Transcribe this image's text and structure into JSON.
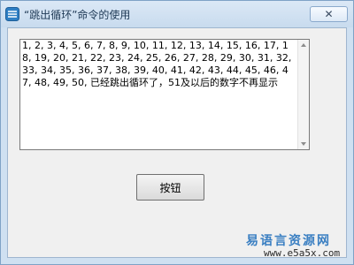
{
  "window": {
    "title": "“跳出循环”命令的使用",
    "close_icon": "close-icon",
    "app_icon": "app-icon"
  },
  "output": {
    "text": "1, 2, 3, 4, 5, 6, 7, 8, 9, 10, 11, 12, 13, 14, 15, 16, 17, 18, 19, 20, 21, 22, 23, 24, 25, 26, 27, 28, 29, 30, 31, 32, 33, 34, 35, 36, 37, 38, 39, 40, 41, 42, 43, 44, 45, 46, 47, 48, 49, 50, 已经跳出循环了，51及以后的数字不再显示"
  },
  "button": {
    "label": "按钮"
  },
  "watermark": {
    "title": "易语言资源网",
    "url": "www.e5a5x.com"
  },
  "colors": {
    "frame": "#c9dcee",
    "watermark_text": "#3a7fc2"
  }
}
